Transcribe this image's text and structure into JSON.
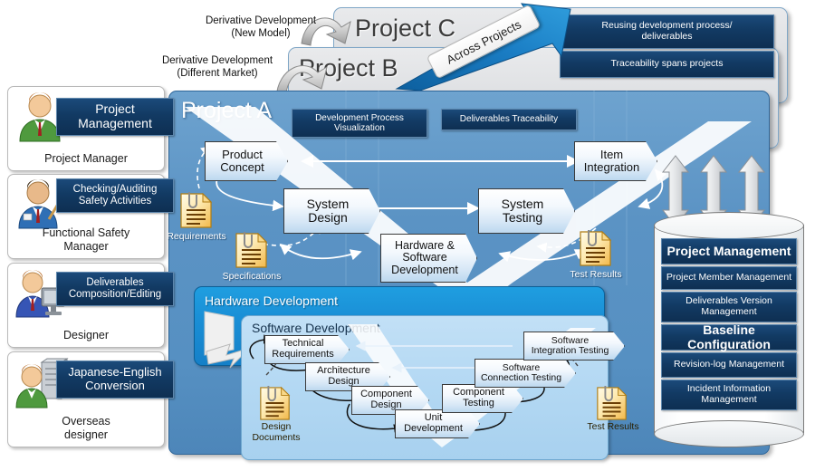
{
  "personas": [
    {
      "role": "Project Manager",
      "tag": "Project\nManagement",
      "icon": "person-green-suit-icon"
    },
    {
      "role": "Functional Safety\nManager",
      "tag": "Checking/Auditing\nSafety Activities",
      "icon": "person-blue-suit-pointer-icon"
    },
    {
      "role": "Designer",
      "tag": "Deliverables\nComposition/Editing",
      "icon": "person-with-monitor-icon"
    },
    {
      "role": "Overseas\ndesigner",
      "tag": "Japanese-English\nConversion",
      "icon": "person-with-server-icon"
    }
  ],
  "projects": {
    "c_title": "Project C",
    "b_title": "Project B",
    "a_title": "Project A",
    "across_label": "Across Projects",
    "derivative_new_model": "Derivative Development\n(New Model)",
    "derivative_different_market": "Derivative Development\n(Different Market)",
    "cross_banners": [
      "Reusing development process/\ndeliverables",
      "Traceability spans  projects"
    ]
  },
  "project_a": {
    "banners": [
      "Development Process\nVisualization",
      "Deliverables Traceability"
    ],
    "v_model": [
      {
        "label": "Product\nConcept",
        "side": "left"
      },
      {
        "label": "System\nDesign",
        "side": "left"
      },
      {
        "label": "Hardware &\nSoftware\nDevelopment",
        "side": "bottom"
      },
      {
        "label": "System\nTesting",
        "side": "right"
      },
      {
        "label": "Item\nIntegration",
        "side": "right"
      }
    ],
    "documents": [
      {
        "label": "Requirements",
        "theme": "light"
      },
      {
        "label": "Specifications",
        "theme": "light"
      },
      {
        "label": "Test Results",
        "theme": "light"
      }
    ]
  },
  "hardware_development": {
    "title": "Hardware Development"
  },
  "software_development": {
    "title": "Software Development",
    "v_model": [
      {
        "label": "Technical\nRequirements"
      },
      {
        "label": "Architecture\nDesign"
      },
      {
        "label": "Component\nDesign"
      },
      {
        "label": "Unit\nDevelopment"
      },
      {
        "label": "Component\nTesting"
      },
      {
        "label": "Software\nConnection Testing"
      },
      {
        "label": "Software\nIntegration Testing"
      }
    ],
    "documents": [
      {
        "label": "Design\nDocuments"
      },
      {
        "label": "Test Results"
      }
    ]
  },
  "database": {
    "rows": [
      {
        "label": "Project Management",
        "emphasis": true
      },
      {
        "label": "Project Member Management",
        "emphasis": false
      },
      {
        "label": "Deliverables Version\nManagement",
        "emphasis": false
      },
      {
        "label": "Baseline Configuration",
        "emphasis": true
      },
      {
        "label": "Revision-log Management",
        "emphasis": false
      },
      {
        "label": "Incident Information\nManagement",
        "emphasis": false
      }
    ]
  },
  "colors": {
    "navy": "#123a63",
    "project_a_blue": "#5b93c4",
    "hardware_blue": "#1a8fd6",
    "software_blue": "#b3d8f3",
    "accent_arrow": "#1a7dc4",
    "doc_yellow": "#f7d77a"
  }
}
